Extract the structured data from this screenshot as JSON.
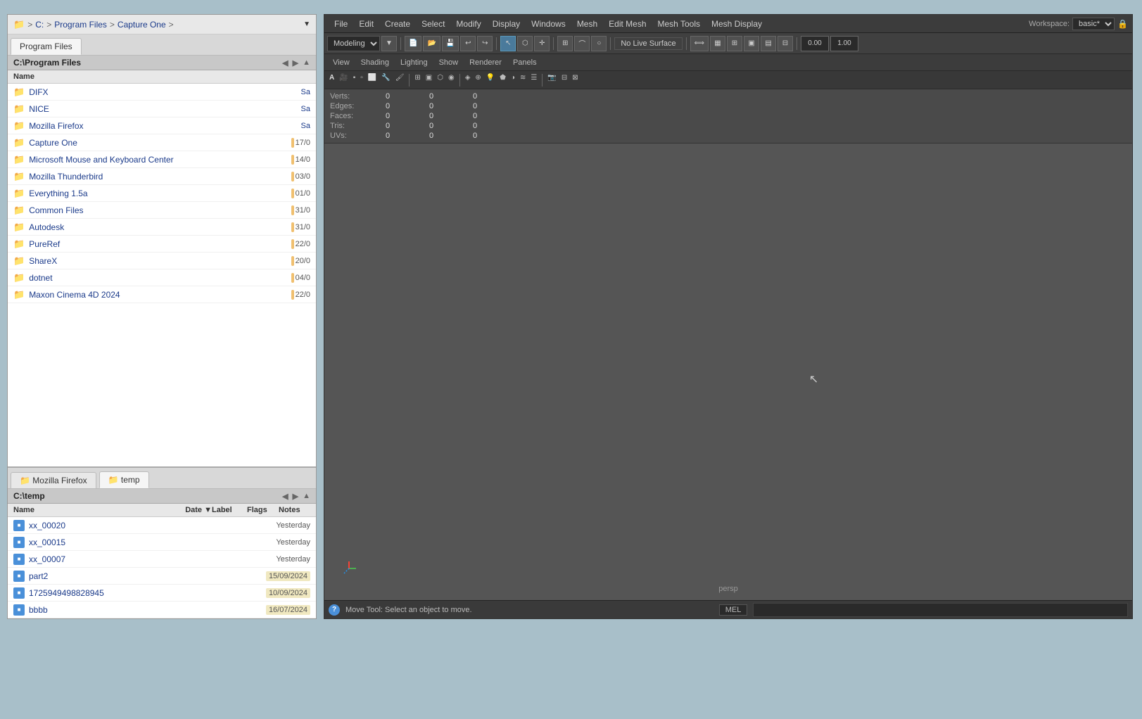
{
  "breadcrumb": {
    "path": [
      "C:",
      "Program Files",
      "Capture One"
    ],
    "seps": [
      ">",
      ">",
      ">"
    ]
  },
  "top_tab": "Program Files",
  "top_panel": {
    "path": "C:\\Program Files",
    "folders": [
      {
        "name": "DIFX",
        "badge": "Sa"
      },
      {
        "name": "NICE",
        "badge": "Sa"
      },
      {
        "name": "Mozilla Firefox",
        "badge": "Sa"
      },
      {
        "name": "Capture One",
        "num": "17/0"
      },
      {
        "name": "Microsoft Mouse and Keyboard Center",
        "num": "14/0"
      },
      {
        "name": "Mozilla Thunderbird",
        "num": "03/0"
      },
      {
        "name": "Everything 1.5a",
        "num": "01/0"
      },
      {
        "name": "Common Files",
        "num": "31/0"
      },
      {
        "name": "Autodesk",
        "num": "31/0"
      },
      {
        "name": "PureRef",
        "num": "22/0"
      },
      {
        "name": "ShareX",
        "num": "20/0"
      },
      {
        "name": "dotnet",
        "num": "04/0"
      },
      {
        "name": "Maxon Cinema 4D 2024",
        "num": "22/0"
      }
    ]
  },
  "lower_tabs": [
    {
      "label": "Mozilla Firefox",
      "active": false
    },
    {
      "label": "temp",
      "active": true
    }
  ],
  "lower_panel": {
    "path": "C:\\temp",
    "columns": [
      "Name",
      "Date",
      "Label",
      "Flags",
      "Notes"
    ],
    "files": [
      {
        "name": "xx_00020",
        "date": "Yesterday",
        "date_highlight": false
      },
      {
        "name": "xx_00015",
        "date": "Yesterday",
        "date_highlight": false
      },
      {
        "name": "xx_00007",
        "date": "Yesterday",
        "date_highlight": false
      },
      {
        "name": "part2",
        "date": "15/09/2024",
        "date_highlight": true
      },
      {
        "name": "1725949498828945",
        "date": "10/09/2024",
        "date_highlight": true
      },
      {
        "name": "bbbb",
        "date": "16/07/2024",
        "date_highlight": true
      }
    ]
  },
  "maya": {
    "menubar": [
      "File",
      "Edit",
      "Create",
      "Select",
      "Modify",
      "Display",
      "Windows",
      "Mesh",
      "Edit Mesh",
      "Mesh Tools",
      "Mesh Display"
    ],
    "workspace_label": "Workspace:",
    "workspace_value": "basic*",
    "toolbar_mode": "Modeling",
    "no_live_surface": "No Live Surface",
    "viewport_menus": [
      "View",
      "Shading",
      "Lighting",
      "Show",
      "Renderer",
      "Panels"
    ],
    "mesh_info": {
      "headers": [
        "",
        "",
        "",
        ""
      ],
      "rows": [
        {
          "label": "Verts:",
          "v1": "0",
          "v2": "0",
          "v3": "0"
        },
        {
          "label": "Edges:",
          "v1": "0",
          "v2": "0",
          "v3": "0"
        },
        {
          "label": "Faces:",
          "v1": "0",
          "v2": "0",
          "v3": "0"
        },
        {
          "label": "Tris:",
          "v1": "0",
          "v2": "0",
          "v3": "0"
        },
        {
          "label": "UVs:",
          "v1": "0",
          "v2": "0",
          "v3": "0"
        }
      ]
    },
    "viewport_label": "persp",
    "statusbar": {
      "text": "Move Tool: Select an object to move.",
      "mel": "MEL"
    },
    "num1": "0.00",
    "num2": "1.00"
  }
}
